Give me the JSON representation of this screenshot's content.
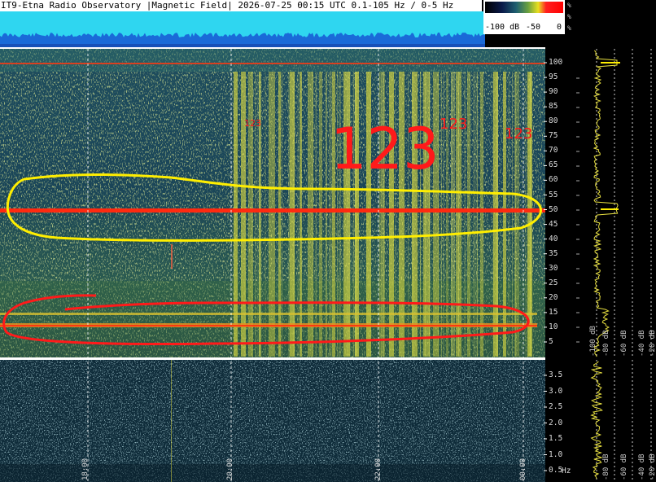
{
  "title": "IT9-Etna Radio Observatory |Magnetic Field| 2026-07-25 00:15 UTC 0.1-105 Hz / 0-5 Hz",
  "colorbar": {
    "labels": [
      "-100 dB",
      "-50",
      "0"
    ],
    "percent": [
      "%",
      "%",
      "%"
    ]
  },
  "main_spectrogram": {
    "y_ticks": [
      "100",
      "95",
      "90",
      "85",
      "80",
      "75",
      "70",
      "65",
      "60",
      "55",
      "50",
      "45",
      "40",
      "35",
      "30",
      "25",
      "20",
      "15",
      "10",
      "5"
    ],
    "annotations": [
      "123",
      "123",
      "123",
      "123"
    ]
  },
  "lower_spectrogram": {
    "y_ticks": [
      "3.5",
      "3.0",
      "2.5",
      "2.0",
      "1.5",
      "1.0",
      "0.5"
    ],
    "unit": "Hz"
  },
  "time_axis": [
    "18:00",
    "20:00",
    "22:00",
    "00:00"
  ],
  "right_panel": {
    "upper_db_labels": [
      "-100 dB",
      "-80 dB",
      "-60 dB",
      "-40 dB",
      "-20 dB"
    ],
    "lower_db_labels": [
      "-80 dB",
      "-60 dB",
      "-40 dB",
      "-20 dB"
    ]
  },
  "colors": {
    "background": "#173e52",
    "hum_line": "#ff2a10",
    "yellow_annotation": "#ffee00",
    "red_annotation": "#ff1a1a",
    "level_strip": "#2fd6f0"
  }
}
